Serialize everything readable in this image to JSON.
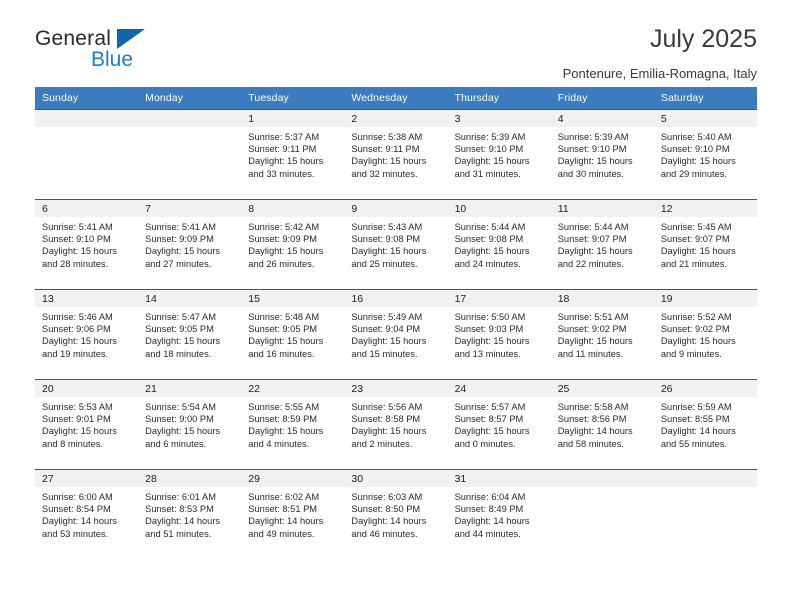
{
  "brand": {
    "word1": "General",
    "word2": "Blue",
    "triangle_color": "#1464aa",
    "blue_color": "#1a7fd4"
  },
  "header": {
    "title": "July 2025",
    "subtitle": "Pontenure, Emilia-Romagna, Italy"
  },
  "theme": {
    "header_bg": "#3a7cbe",
    "row_border": "#1f5fa0",
    "daynum_bg": "#f1f1f1",
    "text": "#2b2b2b"
  },
  "calendar": {
    "weekday_headers": [
      "Sunday",
      "Monday",
      "Tuesday",
      "Wednesday",
      "Thursday",
      "Friday",
      "Saturday"
    ],
    "labels": {
      "sunrise": "Sunrise:",
      "sunset": "Sunset:",
      "daylight": "Daylight:"
    },
    "weeks": [
      [
        {
          "day": ""
        },
        {
          "day": ""
        },
        {
          "day": "1",
          "sunrise": "Sunrise: 5:37 AM",
          "sunset": "Sunset: 9:11 PM",
          "daylight_1": "Daylight: 15 hours",
          "daylight_2": "and 33 minutes."
        },
        {
          "day": "2",
          "sunrise": "Sunrise: 5:38 AM",
          "sunset": "Sunset: 9:11 PM",
          "daylight_1": "Daylight: 15 hours",
          "daylight_2": "and 32 minutes."
        },
        {
          "day": "3",
          "sunrise": "Sunrise: 5:39 AM",
          "sunset": "Sunset: 9:10 PM",
          "daylight_1": "Daylight: 15 hours",
          "daylight_2": "and 31 minutes."
        },
        {
          "day": "4",
          "sunrise": "Sunrise: 5:39 AM",
          "sunset": "Sunset: 9:10 PM",
          "daylight_1": "Daylight: 15 hours",
          "daylight_2": "and 30 minutes."
        },
        {
          "day": "5",
          "sunrise": "Sunrise: 5:40 AM",
          "sunset": "Sunset: 9:10 PM",
          "daylight_1": "Daylight: 15 hours",
          "daylight_2": "and 29 minutes."
        }
      ],
      [
        {
          "day": "6",
          "sunrise": "Sunrise: 5:41 AM",
          "sunset": "Sunset: 9:10 PM",
          "daylight_1": "Daylight: 15 hours",
          "daylight_2": "and 28 minutes."
        },
        {
          "day": "7",
          "sunrise": "Sunrise: 5:41 AM",
          "sunset": "Sunset: 9:09 PM",
          "daylight_1": "Daylight: 15 hours",
          "daylight_2": "and 27 minutes."
        },
        {
          "day": "8",
          "sunrise": "Sunrise: 5:42 AM",
          "sunset": "Sunset: 9:09 PM",
          "daylight_1": "Daylight: 15 hours",
          "daylight_2": "and 26 minutes."
        },
        {
          "day": "9",
          "sunrise": "Sunrise: 5:43 AM",
          "sunset": "Sunset: 9:08 PM",
          "daylight_1": "Daylight: 15 hours",
          "daylight_2": "and 25 minutes."
        },
        {
          "day": "10",
          "sunrise": "Sunrise: 5:44 AM",
          "sunset": "Sunset: 9:08 PM",
          "daylight_1": "Daylight: 15 hours",
          "daylight_2": "and 24 minutes."
        },
        {
          "day": "11",
          "sunrise": "Sunrise: 5:44 AM",
          "sunset": "Sunset: 9:07 PM",
          "daylight_1": "Daylight: 15 hours",
          "daylight_2": "and 22 minutes."
        },
        {
          "day": "12",
          "sunrise": "Sunrise: 5:45 AM",
          "sunset": "Sunset: 9:07 PM",
          "daylight_1": "Daylight: 15 hours",
          "daylight_2": "and 21 minutes."
        }
      ],
      [
        {
          "day": "13",
          "sunrise": "Sunrise: 5:46 AM",
          "sunset": "Sunset: 9:06 PM",
          "daylight_1": "Daylight: 15 hours",
          "daylight_2": "and 19 minutes."
        },
        {
          "day": "14",
          "sunrise": "Sunrise: 5:47 AM",
          "sunset": "Sunset: 9:05 PM",
          "daylight_1": "Daylight: 15 hours",
          "daylight_2": "and 18 minutes."
        },
        {
          "day": "15",
          "sunrise": "Sunrise: 5:48 AM",
          "sunset": "Sunset: 9:05 PM",
          "daylight_1": "Daylight: 15 hours",
          "daylight_2": "and 16 minutes."
        },
        {
          "day": "16",
          "sunrise": "Sunrise: 5:49 AM",
          "sunset": "Sunset: 9:04 PM",
          "daylight_1": "Daylight: 15 hours",
          "daylight_2": "and 15 minutes."
        },
        {
          "day": "17",
          "sunrise": "Sunrise: 5:50 AM",
          "sunset": "Sunset: 9:03 PM",
          "daylight_1": "Daylight: 15 hours",
          "daylight_2": "and 13 minutes."
        },
        {
          "day": "18",
          "sunrise": "Sunrise: 5:51 AM",
          "sunset": "Sunset: 9:02 PM",
          "daylight_1": "Daylight: 15 hours",
          "daylight_2": "and 11 minutes."
        },
        {
          "day": "19",
          "sunrise": "Sunrise: 5:52 AM",
          "sunset": "Sunset: 9:02 PM",
          "daylight_1": "Daylight: 15 hours",
          "daylight_2": "and 9 minutes."
        }
      ],
      [
        {
          "day": "20",
          "sunrise": "Sunrise: 5:53 AM",
          "sunset": "Sunset: 9:01 PM",
          "daylight_1": "Daylight: 15 hours",
          "daylight_2": "and 8 minutes."
        },
        {
          "day": "21",
          "sunrise": "Sunrise: 5:54 AM",
          "sunset": "Sunset: 9:00 PM",
          "daylight_1": "Daylight: 15 hours",
          "daylight_2": "and 6 minutes."
        },
        {
          "day": "22",
          "sunrise": "Sunrise: 5:55 AM",
          "sunset": "Sunset: 8:59 PM",
          "daylight_1": "Daylight: 15 hours",
          "daylight_2": "and 4 minutes."
        },
        {
          "day": "23",
          "sunrise": "Sunrise: 5:56 AM",
          "sunset": "Sunset: 8:58 PM",
          "daylight_1": "Daylight: 15 hours",
          "daylight_2": "and 2 minutes."
        },
        {
          "day": "24",
          "sunrise": "Sunrise: 5:57 AM",
          "sunset": "Sunset: 8:57 PM",
          "daylight_1": "Daylight: 15 hours",
          "daylight_2": "and 0 minutes."
        },
        {
          "day": "25",
          "sunrise": "Sunrise: 5:58 AM",
          "sunset": "Sunset: 8:56 PM",
          "daylight_1": "Daylight: 14 hours",
          "daylight_2": "and 58 minutes."
        },
        {
          "day": "26",
          "sunrise": "Sunrise: 5:59 AM",
          "sunset": "Sunset: 8:55 PM",
          "daylight_1": "Daylight: 14 hours",
          "daylight_2": "and 55 minutes."
        }
      ],
      [
        {
          "day": "27",
          "sunrise": "Sunrise: 6:00 AM",
          "sunset": "Sunset: 8:54 PM",
          "daylight_1": "Daylight: 14 hours",
          "daylight_2": "and 53 minutes."
        },
        {
          "day": "28",
          "sunrise": "Sunrise: 6:01 AM",
          "sunset": "Sunset: 8:53 PM",
          "daylight_1": "Daylight: 14 hours",
          "daylight_2": "and 51 minutes."
        },
        {
          "day": "29",
          "sunrise": "Sunrise: 6:02 AM",
          "sunset": "Sunset: 8:51 PM",
          "daylight_1": "Daylight: 14 hours",
          "daylight_2": "and 49 minutes."
        },
        {
          "day": "30",
          "sunrise": "Sunrise: 6:03 AM",
          "sunset": "Sunset: 8:50 PM",
          "daylight_1": "Daylight: 14 hours",
          "daylight_2": "and 46 minutes."
        },
        {
          "day": "31",
          "sunrise": "Sunrise: 6:04 AM",
          "sunset": "Sunset: 8:49 PM",
          "daylight_1": "Daylight: 14 hours",
          "daylight_2": "and 44 minutes."
        },
        {
          "day": ""
        },
        {
          "day": ""
        }
      ]
    ]
  }
}
